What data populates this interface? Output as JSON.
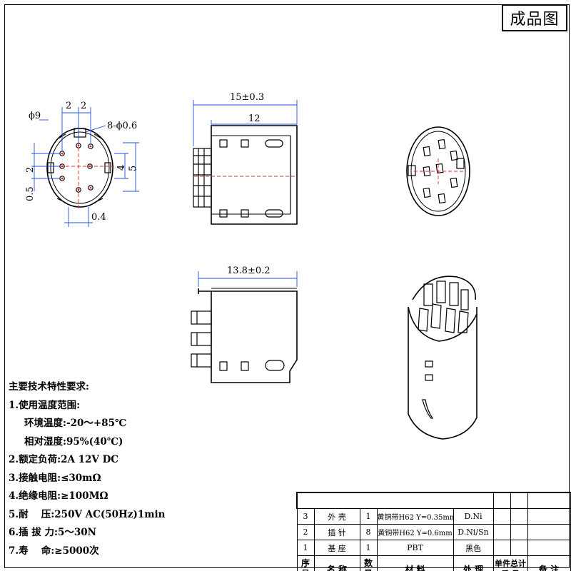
{
  "title_block": {
    "title": "成品图"
  },
  "dimensions": {
    "front": {
      "diameter": "ϕ9",
      "pitch_a": "2",
      "pitch_b": "2",
      "pins": "8-ϕ0.6",
      "left_2": "2",
      "left_05": "0.5",
      "right_4": "4",
      "right_5": "5",
      "bottom_04": "0.4"
    },
    "side_top": {
      "overall": "15±0.3",
      "body": "12"
    },
    "side_bottom": {
      "overall": "13.8±0.2"
    }
  },
  "spec": {
    "heading": "主要技术特性要求:",
    "lines": [
      "1.使用温度范围:",
      "环境温度:-20～+85℃",
      "相对湿度:95%(40℃)",
      "2.额定负荷:2A 12V DC",
      "3.接触电阻:≤30mΩ",
      "4.绝缘电阻:≥100MΩ",
      "5.耐　 压:250V AC(50Hz)1min",
      "6.插 拔 力:5～30N",
      "7.寿　 命:≥5000次"
    ]
  },
  "bom": {
    "rows": [
      {
        "no": "3",
        "name": "外 壳",
        "qty": "1",
        "material": "黄铜带H62 Y=0.35mm",
        "finish": "D.Ni"
      },
      {
        "no": "2",
        "name": "插 针",
        "qty": "8",
        "material": "黄铜带H62 Y=0.6mm",
        "finish": "D.Ni/Sn"
      },
      {
        "no": "1",
        "name": "基 座",
        "qty": "1",
        "material": "PBT",
        "finish": "黑色"
      }
    ],
    "header": {
      "no_top": "序",
      "no_bottom": "号",
      "name": "名 称",
      "qty_top": "数",
      "qty_bottom": "量",
      "material": "材 料",
      "finish": "处 理",
      "unit": "单件",
      "total": "总计",
      "weight": "质 量",
      "remarks": "备 注"
    }
  }
}
